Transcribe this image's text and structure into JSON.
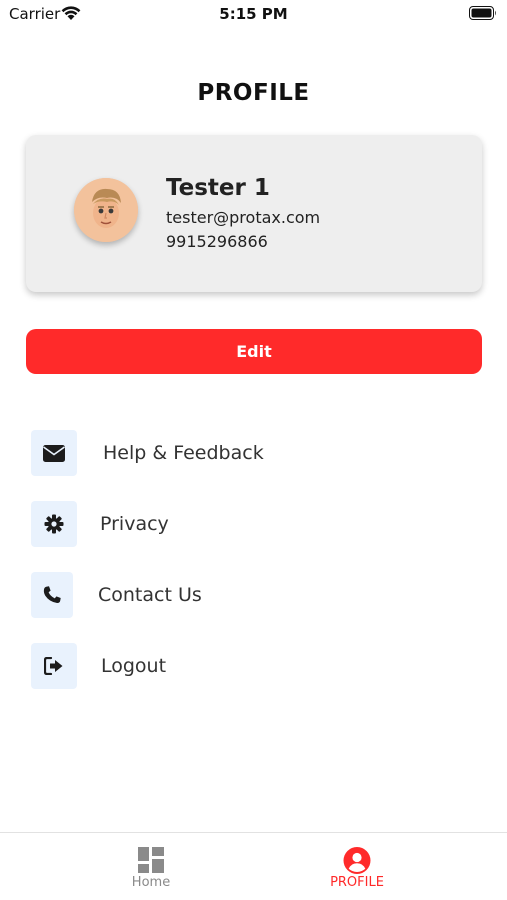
{
  "status_bar": {
    "carrier": "Carrier",
    "time": "5:15 PM"
  },
  "header": {
    "title": "PROFILE"
  },
  "profile": {
    "name": "Tester 1",
    "email": "tester@protax.com",
    "phone": "9915296866"
  },
  "edit_button": {
    "label": "Edit"
  },
  "menu": {
    "items": [
      {
        "label": "Help & Feedback",
        "icon": "envelope-icon"
      },
      {
        "label": "Privacy",
        "icon": "gear-icon"
      },
      {
        "label": "Contact Us",
        "icon": "phone-icon"
      },
      {
        "label": "Logout",
        "icon": "logout-icon"
      }
    ]
  },
  "tab_bar": {
    "tabs": [
      {
        "label": "Home",
        "icon": "dashboard-icon"
      },
      {
        "label": "PROFILE",
        "icon": "user-circle-icon",
        "active": true
      }
    ]
  },
  "colors": {
    "accent": "#ff2a2a",
    "icon_bg": "#e9f2fd",
    "card_bg": "#eeeeee"
  }
}
